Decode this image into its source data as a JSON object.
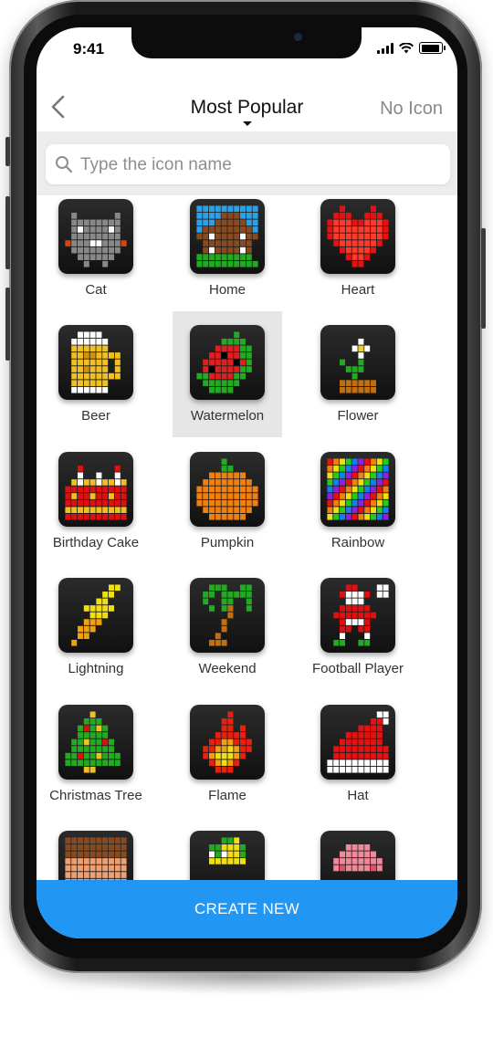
{
  "status": {
    "time": "9:41"
  },
  "nav": {
    "title": "Most Popular",
    "right_action": "No Icon"
  },
  "search": {
    "placeholder": "Type the icon name"
  },
  "icons": [
    {
      "label": "Cat",
      "icon": "cat-pixel-icon",
      "colors": [
        "#888888",
        "#e04010",
        "#ffffff"
      ]
    },
    {
      "label": "Home",
      "icon": "home-pixel-icon",
      "colors": [
        "#2aa0e8",
        "#8a4a20",
        "#ffffff",
        "#22aa22"
      ]
    },
    {
      "label": "Heart",
      "icon": "heart-pixel-icon",
      "colors": [
        "#e81010",
        "#ff3a2a"
      ]
    },
    {
      "label": "Beer",
      "icon": "beer-pixel-icon",
      "colors": [
        "#f0c020",
        "#ffffff",
        "#d89010"
      ]
    },
    {
      "label": "Watermelon",
      "icon": "watermelon-pixel-icon",
      "colors": [
        "#e02020",
        "#22aa22",
        "#000000"
      ],
      "selected": true
    },
    {
      "label": "Flower",
      "icon": "flower-pixel-icon",
      "colors": [
        "#ffffff",
        "#f0d020",
        "#22aa22",
        "#c07010"
      ]
    },
    {
      "label": "Birthday Cake",
      "icon": "cake-pixel-icon",
      "colors": [
        "#e01010",
        "#f0c020",
        "#ffffff"
      ]
    },
    {
      "label": "Pumpkin",
      "icon": "pumpkin-pixel-icon",
      "colors": [
        "#f08010",
        "#22aa22"
      ]
    },
    {
      "label": "Rainbow",
      "icon": "rainbow-pixel-icon",
      "colors": [
        "#e81010",
        "#f08010",
        "#f0e010",
        "#22cc22",
        "#1080f0",
        "#9020e0"
      ]
    },
    {
      "label": "Lightning",
      "icon": "lightning-pixel-icon",
      "colors": [
        "#f0e010",
        "#f0a010"
      ]
    },
    {
      "label": "Weekend",
      "icon": "palm-pixel-icon",
      "colors": [
        "#22aa22",
        "#c07010"
      ]
    },
    {
      "label": "Football Player",
      "icon": "football-player-pixel-icon",
      "colors": [
        "#e01010",
        "#ffffff",
        "#22aa22"
      ]
    },
    {
      "label": "Christmas Tree",
      "icon": "christmas-tree-pixel-icon",
      "colors": [
        "#22aa22",
        "#e01010",
        "#f0c020"
      ]
    },
    {
      "label": "Flame",
      "icon": "flame-pixel-icon",
      "colors": [
        "#e82010",
        "#f0a010",
        "#f0e010"
      ]
    },
    {
      "label": "Hat",
      "icon": "hat-pixel-icon",
      "colors": [
        "#e81010",
        "#ffffff"
      ]
    },
    {
      "label": "",
      "icon": "face-pixel-icon",
      "colors": [
        "#8a4a20",
        "#f0a070"
      ]
    },
    {
      "label": "",
      "icon": "character-pixel-icon",
      "colors": [
        "#22aa22",
        "#f0e010",
        "#ffffff"
      ]
    },
    {
      "label": "",
      "icon": "pink-pixel-icon",
      "colors": [
        "#f08a9a",
        "#e05070"
      ]
    }
  ],
  "cta": {
    "label": "CREATE NEW"
  }
}
